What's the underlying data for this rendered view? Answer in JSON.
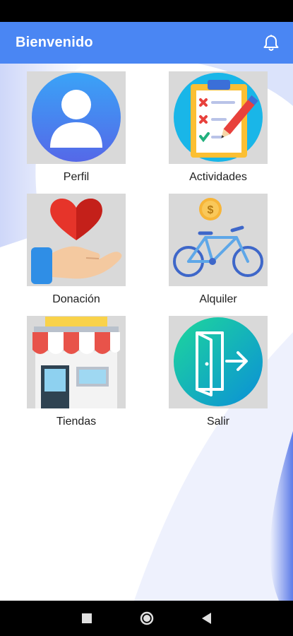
{
  "app_bar": {
    "title": "Bienvenido",
    "accent_color": "#4a86f3",
    "notification_icon": "bell-icon"
  },
  "menu": [
    {
      "label": "Perfil",
      "icon": "user-profile-icon"
    },
    {
      "label": "Actividades",
      "icon": "clipboard-checklist-icon"
    },
    {
      "label": "Donación",
      "icon": "heart-hand-icon"
    },
    {
      "label": "Alquiler",
      "icon": "bicycle-coin-icon"
    },
    {
      "label": "Tiendas",
      "icon": "storefront-icon"
    },
    {
      "label": "Salir",
      "icon": "exit-door-icon"
    }
  ],
  "navigation": {
    "recents_icon": "square-recents-icon",
    "home_icon": "circle-home-icon",
    "back_icon": "triangle-back-icon"
  }
}
